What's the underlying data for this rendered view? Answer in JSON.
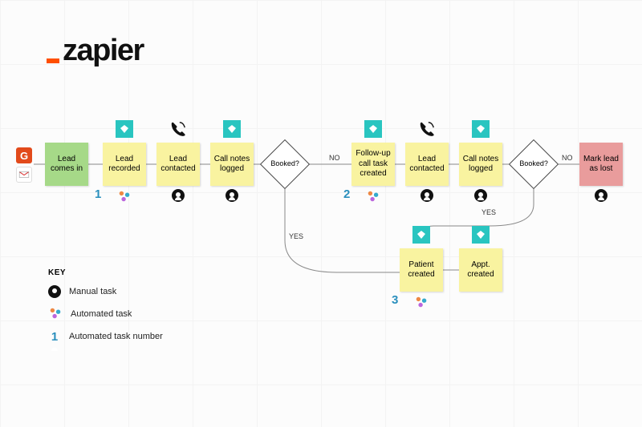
{
  "brand": {
    "name": "zapier"
  },
  "sources": {
    "gravity": "G",
    "gmail": "M"
  },
  "nodes": {
    "lead_in": "Lead comes in",
    "lead_recorded": "Lead recorded",
    "lead_contacted_1": "Lead contacted",
    "notes_1": "Call notes logged",
    "booked_1": "Booked?",
    "followup": "Follow-up call task created",
    "lead_contacted_2": "Lead contacted",
    "notes_2": "Call notes logged",
    "booked_2": "Booked?",
    "mark_lost": "Mark lead as lost",
    "patient": "Patient created",
    "appt": "Appt. created"
  },
  "edges": {
    "no_1": "NO",
    "yes_1": "YES",
    "no_2": "NO",
    "yes_2": "YES"
  },
  "task_numbers": {
    "t1": "1",
    "t2": "2",
    "t3": "3"
  },
  "key": {
    "title": "KEY",
    "manual": "Manual task",
    "auto": "Automated task",
    "num": "Automated task number",
    "num_sample": "1"
  }
}
